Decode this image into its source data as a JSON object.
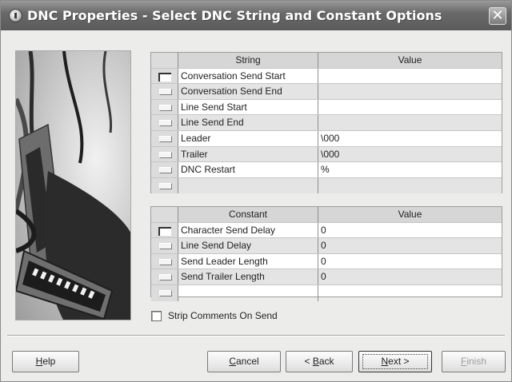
{
  "window": {
    "title": "DNC Properties - Select DNC String and Constant Options",
    "close_symbol": "✕"
  },
  "string_table": {
    "header_name": "String",
    "header_value": "Value",
    "rows": [
      {
        "name": "Conversation Send Start",
        "value": ""
      },
      {
        "name": "Conversation Send End",
        "value": ""
      },
      {
        "name": "Line Send Start",
        "value": ""
      },
      {
        "name": "Line Send End",
        "value": ""
      },
      {
        "name": "Leader",
        "value": "\\000"
      },
      {
        "name": "Trailer",
        "value": "\\000"
      },
      {
        "name": "DNC Restart",
        "value": "%"
      },
      {
        "name": "",
        "value": ""
      }
    ]
  },
  "constant_table": {
    "header_name": "Constant",
    "header_value": "Value",
    "rows": [
      {
        "name": "Character Send Delay",
        "value": "0"
      },
      {
        "name": "Line Send Delay",
        "value": "0"
      },
      {
        "name": "Send Leader Length",
        "value": "0"
      },
      {
        "name": "Send Trailer Length",
        "value": "0"
      },
      {
        "name": "",
        "value": ""
      }
    ]
  },
  "strip_comments": {
    "label": "Strip Comments On Send",
    "checked": false
  },
  "buttons": {
    "help": {
      "pre": "",
      "mnemonic": "H",
      "post": "elp"
    },
    "cancel": {
      "pre": "",
      "mnemonic": "C",
      "post": "ancel"
    },
    "back": {
      "pre": "< ",
      "mnemonic": "B",
      "post": "ack"
    },
    "next": {
      "pre": "",
      "mnemonic": "N",
      "post": "ext >"
    },
    "finish": {
      "pre": "",
      "mnemonic": "F",
      "post": "inish"
    }
  }
}
